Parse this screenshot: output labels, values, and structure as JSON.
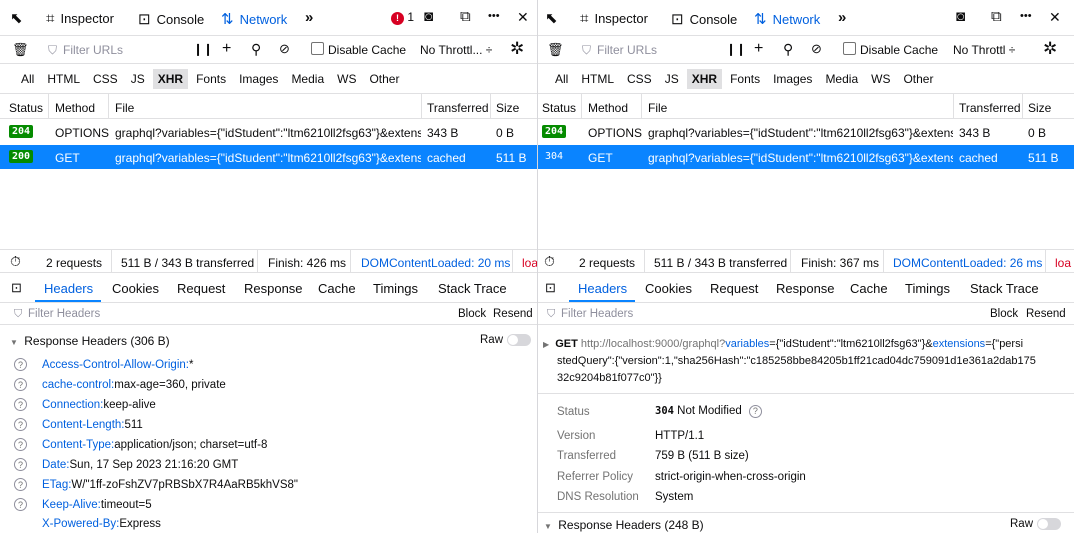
{
  "colors": {
    "accent": "#0060df",
    "selected_row": "#0a84ff",
    "status_ok": "#058b00",
    "error": "#d70022"
  },
  "left": {
    "toolbar": {
      "inspector": "Inspector",
      "console": "Console",
      "network": "Network",
      "more": "»",
      "error_count": "1",
      "dots": "•••",
      "close": "✕"
    },
    "filter": {
      "placeholder": "Filter URLs",
      "disable_cache": "Disable Cache",
      "throttle": "No Throttl... ÷"
    },
    "types": [
      "All",
      "HTML",
      "CSS",
      "JS",
      "XHR",
      "Fonts",
      "Images",
      "Media",
      "WS",
      "Other"
    ],
    "columns": {
      "status": "Status",
      "method": "Method",
      "file": "File",
      "transferred": "Transferred",
      "size": "Size"
    },
    "requests": [
      {
        "status": "204",
        "method": "OPTIONS",
        "file": "graphql?variables={\"idStudent\":\"ltm6210ll2fsg63\"}&extensiol",
        "transferred": "343 B",
        "size": "0 B"
      },
      {
        "status": "200",
        "method": "GET",
        "file": "graphql?variables={\"idStudent\":\"ltm6210ll2fsg63\"}&extensiol",
        "transferred": "cached",
        "size": "511 B"
      }
    ],
    "summary": {
      "requests": "2 requests",
      "transferred": "511 B / 343 B transferred",
      "finish": "Finish: 426 ms",
      "dcl": "DOMContentLoaded: 20 ms",
      "load": "loa"
    },
    "tabs": [
      "Headers",
      "Cookies",
      "Request",
      "Response",
      "Cache",
      "Timings",
      "Stack Trace"
    ],
    "hfilter": {
      "placeholder": "Filter Headers",
      "block": "Block",
      "resend": "Resend"
    },
    "resp_headers_title": "Response Headers (306 B)",
    "raw": "Raw",
    "headers": [
      {
        "k": "Access-Control-Allow-Origin:",
        "v": " *"
      },
      {
        "k": "cache-control:",
        "v": " max-age=360, private"
      },
      {
        "k": "Connection:",
        "v": " keep-alive"
      },
      {
        "k": "Content-Length:",
        "v": " 511"
      },
      {
        "k": "Content-Type:",
        "v": " application/json; charset=utf-8"
      },
      {
        "k": "Date:",
        "v": " Sun, 17 Sep 2023 21:16:20 GMT"
      },
      {
        "k": "ETag:",
        "v": " W/\"1ff-zoFshZV7pRBSbX7R4AaRB5khVS8\""
      },
      {
        "k": "Keep-Alive:",
        "v": " timeout=5"
      },
      {
        "k": "X-Powered-By:",
        "v": " Express"
      }
    ]
  },
  "right": {
    "toolbar": {
      "inspector": "Inspector",
      "console": "Console",
      "network": "Network",
      "more": "»",
      "dots": "•••",
      "close": "✕"
    },
    "filter": {
      "placeholder": "Filter URLs",
      "disable_cache": "Disable Cache",
      "throttle": "No Throttl ÷"
    },
    "types": [
      "All",
      "HTML",
      "CSS",
      "JS",
      "XHR",
      "Fonts",
      "Images",
      "Media",
      "WS",
      "Other"
    ],
    "columns": {
      "status": "Status",
      "method": "Method",
      "file": "File",
      "transferred": "Transferred",
      "size": "Size"
    },
    "requests": [
      {
        "status": "204",
        "method": "OPTIONS",
        "file": "graphql?variables={\"idStudent\":\"ltm6210ll2fsg63\"}&extensiol",
        "transferred": "343 B",
        "size": "0 B"
      },
      {
        "status": "304",
        "method": "GET",
        "file": "graphql?variables={\"idStudent\":\"ltm6210ll2fsg63\"}&extensiol",
        "transferred": "cached",
        "size": "511 B"
      }
    ],
    "summary": {
      "requests": "2 requests",
      "transferred": "511 B / 343 B transferred",
      "finish": "Finish: 367 ms",
      "dcl": "DOMContentLoaded: 26 ms",
      "load": "loa"
    },
    "tabs": [
      "Headers",
      "Cookies",
      "Request",
      "Response",
      "Cache",
      "Timings",
      "Stack Trace"
    ],
    "hfilter": {
      "placeholder": "Filter Headers",
      "block": "Block",
      "resend": "Resend"
    },
    "request_line": {
      "method": "GET",
      "url_base": "http://localhost:9000/graphql?",
      "p1k": "variables",
      "p1v": "={\"idStudent\":\"ltm6210ll2fsg63\"}&",
      "p2k": "extensions",
      "p2v": "={\"persi",
      "line2": "stedQuery\":{\"version\":1,\"sha256Hash\":\"c185258bbe84205b1ff21cad04dc759091d1e361a2dab175",
      "line3": "32c9204b81f077c0\"}}"
    },
    "details": [
      {
        "k": "Status",
        "v": "Not Modified",
        "code": "304"
      },
      {
        "k": "Version",
        "v": "HTTP/1.1"
      },
      {
        "k": "Transferred",
        "v": "759 B (511 B size)"
      },
      {
        "k": "Referrer Policy",
        "v": "strict-origin-when-cross-origin"
      },
      {
        "k": "DNS Resolution",
        "v": "System"
      }
    ],
    "resp_headers_title": "Response Headers (248 B)",
    "raw": "Raw"
  }
}
